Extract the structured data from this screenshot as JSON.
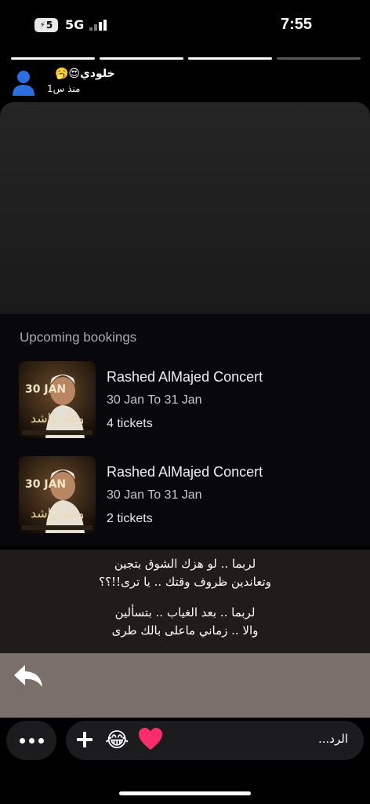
{
  "status_bar": {
    "battery_level": "5",
    "network": "5G",
    "time": "7:55"
  },
  "story_progress": {
    "segments": [
      1,
      1,
      1,
      0
    ]
  },
  "story_header": {
    "username": "خلودي😍🥱",
    "time_ago": "منذ س1"
  },
  "bookings": {
    "title": "Upcoming bookings",
    "items": [
      {
        "name": "Rashed AlMajed Concert",
        "dates": "30 Jan  To 31 Jan",
        "tickets": "4 tickets",
        "poster_date": "30 JAN",
        "poster_title": "وعاد راشد"
      },
      {
        "name": "Rashed AlMajed Concert",
        "dates": "30 Jan  To 31 Jan",
        "tickets": "2 tickets",
        "poster_date": "30 JAN",
        "poster_title": "وعاد راشد"
      }
    ]
  },
  "lyrics": {
    "lines": [
      "لربما .. لو هزك الشوق بتجين",
      "وتعاندين ظروف وقتك .. يا ترى!!؟؟",
      "لربما .. بعد الغياب .. بتسألين",
      "والا .. زماني ماعلى بالك طرى"
    ]
  },
  "reply": {
    "placeholder": "الرد...",
    "icons": [
      "reply-arrow-icon",
      "more-icon",
      "plus-icon",
      "laughing-emoji-icon",
      "heart-icon"
    ]
  },
  "colors": {
    "background": "#000000",
    "bookings_bg": "#08080c",
    "lyrics_bg": "#1f1d1b",
    "reply_zone_bg": "#7a7069",
    "heart": "#ff2d6b"
  }
}
